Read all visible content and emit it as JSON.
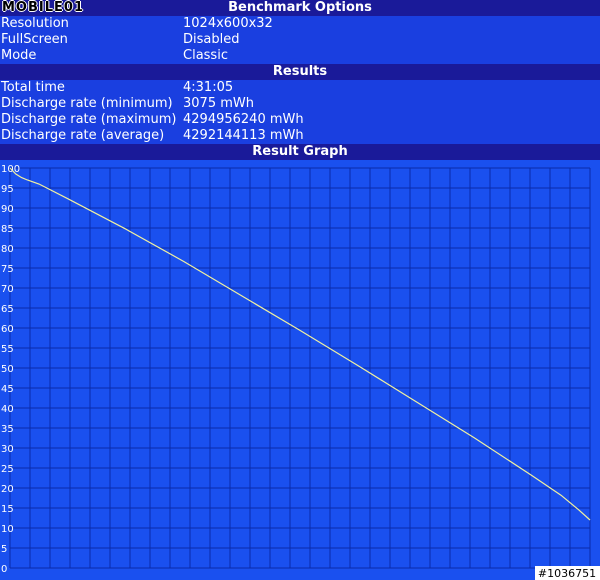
{
  "logo_text": "MOBILE01",
  "benchmark_options": {
    "title": "Benchmark Options",
    "rows": [
      {
        "label": "Resolution",
        "value": "1024x600x32"
      },
      {
        "label": "FullScreen",
        "value": "Disabled"
      },
      {
        "label": "Mode",
        "value": "Classic"
      }
    ]
  },
  "results": {
    "title": "Results",
    "rows": [
      {
        "label": "Total time",
        "value": "4:31:05"
      },
      {
        "label": "Discharge rate (minimum)",
        "value": "3075 mWh"
      },
      {
        "label": "Discharge rate (maximum)",
        "value": "4294956240 mWh"
      },
      {
        "label": "Discharge rate (average)",
        "value": "4292144113 mWh"
      }
    ]
  },
  "graph_title": "Result Graph",
  "watermark": "#1036751",
  "colors": {
    "header": "#1a1a99",
    "row": "#1a3fe0",
    "plot": "#1a50ef",
    "grid": "#0a2aa8",
    "line": "#f0f0a0"
  },
  "chart_data": {
    "type": "line",
    "ylim": [
      0,
      100
    ],
    "y_ticks": [
      0,
      5,
      10,
      15,
      20,
      25,
      30,
      35,
      40,
      45,
      50,
      55,
      60,
      65,
      70,
      75,
      80,
      85,
      90,
      95,
      100
    ],
    "xlim": [
      0,
      100
    ],
    "series": [
      {
        "x": [
          0,
          1,
          2,
          3,
          5,
          10,
          20,
          30,
          40,
          50,
          60,
          70,
          80,
          90,
          95,
          98,
          100
        ],
        "values": [
          100,
          98.5,
          97.6,
          97.0,
          96.0,
          92.3,
          84.7,
          76.6,
          68.0,
          59.4,
          50.6,
          41.6,
          32.6,
          23.1,
          18.2,
          14.6,
          12.0
        ]
      }
    ]
  }
}
